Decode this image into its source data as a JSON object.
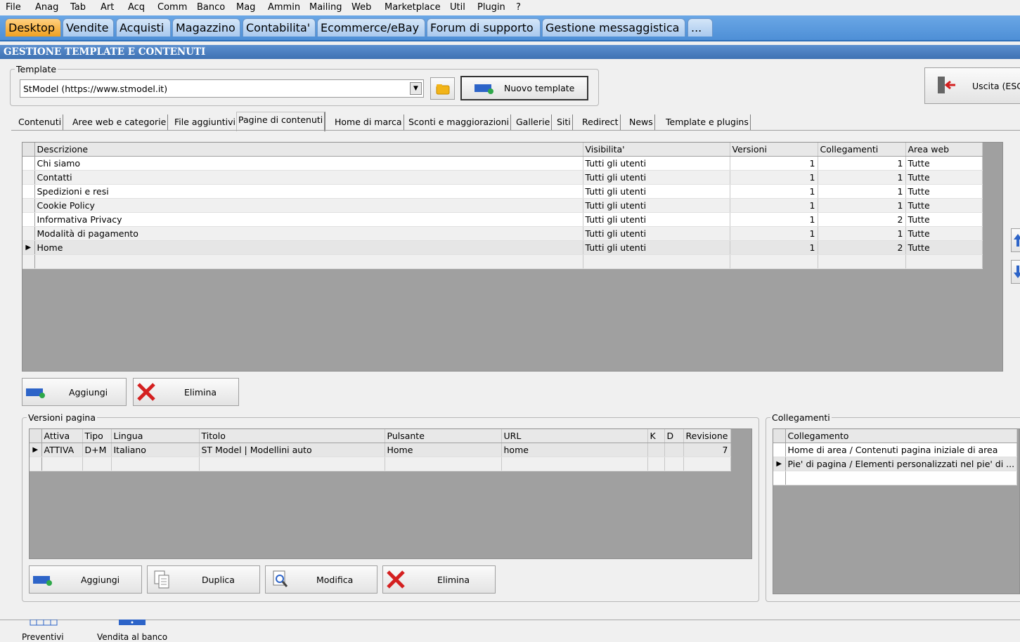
{
  "menu": [
    "File",
    "Anag",
    "Tab",
    "Art",
    "Acq",
    "Comm",
    "Banco",
    "Mag",
    "Ammin",
    "Mailing",
    "Web",
    "Marketplace",
    "Util",
    "Plugin",
    "?"
  ],
  "module_tabs": [
    "Desktop",
    "Vendite",
    "Acquisti",
    "Magazzino",
    "Contabilita'",
    "Ecommerce/eBay",
    "Forum di supporto",
    "Gestione messaggistica",
    "..."
  ],
  "window_title": "GESTIONE TEMPLATE E CONTENUTI",
  "template_group": {
    "legend": "Template",
    "selected": "StModel (https://www.stmodel.it)",
    "new_button": "Nuovo template"
  },
  "exit_button": "Uscita (ESC",
  "sub_tabs": [
    "Contenuti",
    "Aree web e categorie",
    "File aggiuntivi",
    "Pagine di contenuti",
    "Home di marca",
    "Sconti e maggiorazioni",
    "Gallerie",
    "Siti",
    "Redirect",
    "News",
    "Template e plugins"
  ],
  "pages_grid": {
    "columns": [
      "Descrizione",
      "Visibilita'",
      "Versioni",
      "Collegamenti",
      "Area web"
    ],
    "rows": [
      [
        "Chi siamo",
        "Tutti gli utenti",
        "1",
        "1",
        "Tutte"
      ],
      [
        "Contatti",
        "Tutti gli utenti",
        "1",
        "1",
        "Tutte"
      ],
      [
        "Spedizioni e resi",
        "Tutti gli utenti",
        "1",
        "1",
        "Tutte"
      ],
      [
        "Cookie Policy",
        "Tutti gli utenti",
        "1",
        "1",
        "Tutte"
      ],
      [
        "Informativa Privacy",
        "Tutti gli utenti",
        "1",
        "2",
        "Tutte"
      ],
      [
        "Modalità di pagamento",
        "Tutti gli utenti",
        "1",
        "1",
        "Tutte"
      ],
      [
        "Home",
        "Tutti gli utenti",
        "1",
        "2",
        "Tutte"
      ]
    ]
  },
  "pages_buttons": {
    "add": "Aggiungi",
    "delete": "Elimina"
  },
  "versions_group": {
    "legend": "Versioni pagina",
    "columns": [
      "Attiva",
      "Tipo",
      "Lingua",
      "Titolo",
      "Pulsante",
      "URL",
      "K",
      "D",
      "Revisione"
    ],
    "rows": [
      [
        "ATTIVA",
        "D+M",
        "Italiano",
        "ST Model | Modellini auto",
        "Home",
        "home",
        "",
        "",
        "7"
      ]
    ],
    "buttons": {
      "add": "Aggiungi",
      "duplicate": "Duplica",
      "edit": "Modifica",
      "delete": "Elimina"
    }
  },
  "links_group": {
    "legend": "Collegamenti",
    "column": "Collegamento",
    "rows": [
      "Home di area / Contenuti pagina iniziale di area",
      "Pie' di pagina / Elementi personalizzati nel pie' di ..."
    ]
  },
  "bottom_shortcuts": [
    "Preventivi",
    "Vendita al banco"
  ]
}
